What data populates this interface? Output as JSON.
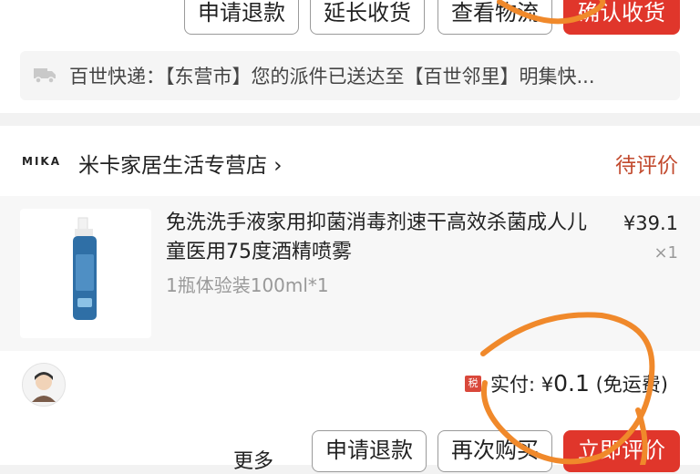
{
  "top_actions": {
    "refund": "申请退款",
    "extend": "延长收货",
    "logistics": "查看物流",
    "confirm": "确认收货"
  },
  "logistics": {
    "icon": "truck-icon",
    "text": "百世快递：【东营市】您的派件已送达至【百世邻里】明集快..."
  },
  "store": {
    "logo": "MIKA",
    "name": "米卡家居生活专营店 ›",
    "status": "待评价"
  },
  "product": {
    "title": "免洗洗手液家用抑菌消毒剂速干高效杀菌成人儿童医用75度酒精喷雾",
    "sku": "1瓶体验装100ml*1",
    "price": "¥39.1",
    "qty": "×1"
  },
  "payment": {
    "tax_badge": "税",
    "label": "实付: ¥",
    "amount": "0.1",
    "note": "(免运费)"
  },
  "bottom_actions": {
    "more": "更多",
    "refund": "申请退款",
    "rebuy": "再次购买",
    "review": "立即评价"
  },
  "colors": {
    "accent_red": "#e0362b",
    "status_red": "#c24a2e",
    "annotation_orange": "#f0892b"
  }
}
